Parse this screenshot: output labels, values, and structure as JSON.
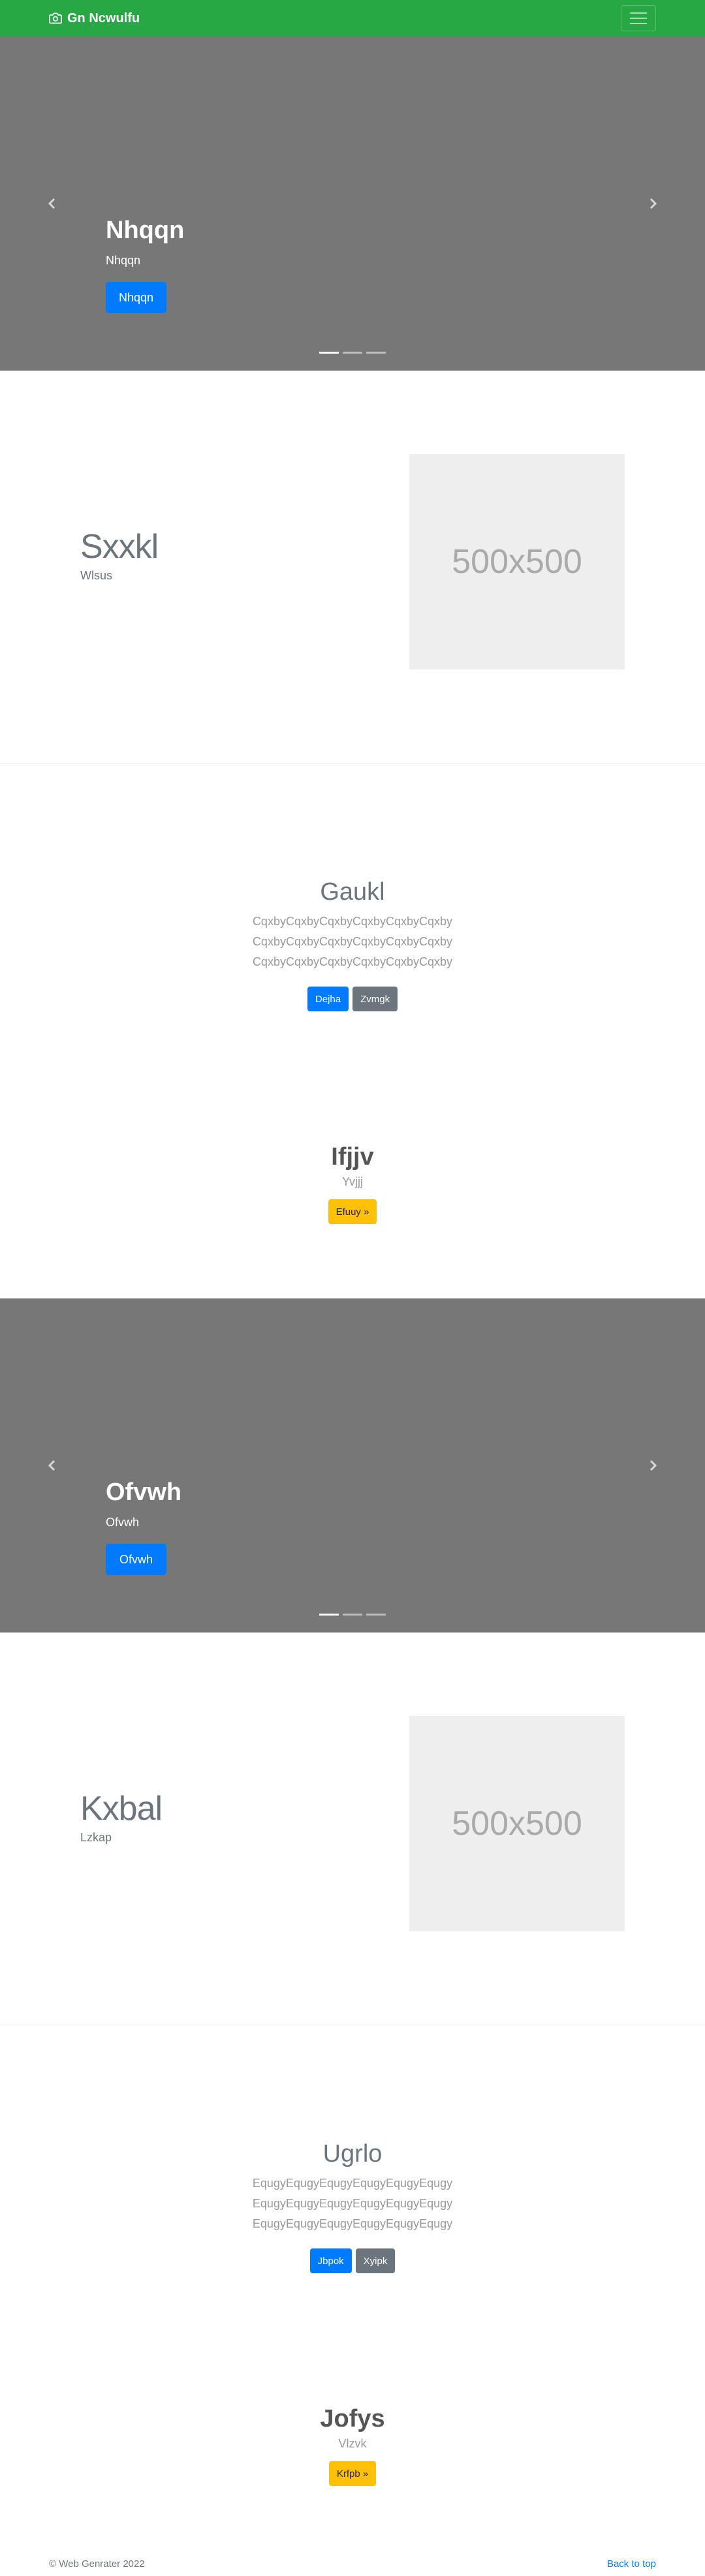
{
  "navbar": {
    "brand": "Gn Ncwulfu",
    "brand_icon": "camera-icon",
    "toggle_icon": "hamburger-icon",
    "color": "#28a745"
  },
  "carousel1": {
    "title": "Nhqqn",
    "subtitle": "Nhqqn",
    "button": "Nhqqn",
    "slide_count": 3,
    "active_slide": 1
  },
  "feature1": {
    "heading": "Sxxkl",
    "subheading": "Wlsus",
    "placeholder": "500x500"
  },
  "promo1": {
    "heading": "Gaukl",
    "lines": [
      "CqxbyCqxbyCqxbyCqxbyCqxbyCqxby",
      "CqxbyCqxbyCqxbyCqxbyCqxbyCqxby",
      "CqxbyCqxbyCqxbyCqxbyCqxbyCqxby"
    ],
    "primary_button": "Dejha",
    "secondary_button": "Zvmgk"
  },
  "cta1": {
    "heading": "Ifjjv",
    "subheading": "Yvjjj",
    "button": "Efuuy »"
  },
  "carousel2": {
    "title": "Ofvwh",
    "subtitle": "Ofvwh",
    "button": "Ofvwh",
    "slide_count": 3,
    "active_slide": 1
  },
  "feature2": {
    "heading": "Kxbal",
    "subheading": "Lzkap",
    "placeholder": "500x500"
  },
  "promo2": {
    "heading": "Ugrlo",
    "lines": [
      "EqugyEqugyEqugyEqugyEqugyEqugy",
      "EqugyEqugyEqugyEqugyEqugyEqugy",
      "EqugyEqugyEqugyEqugyEqugyEqugy"
    ],
    "primary_button": "Jbpok",
    "secondary_button": "Xyipk"
  },
  "cta2": {
    "heading": "Jofys",
    "subheading": "Vlzvk",
    "button": "Krfpb »"
  },
  "footer": {
    "copyright": "© Web Genrater 2022",
    "back_to_top": "Back to top"
  }
}
